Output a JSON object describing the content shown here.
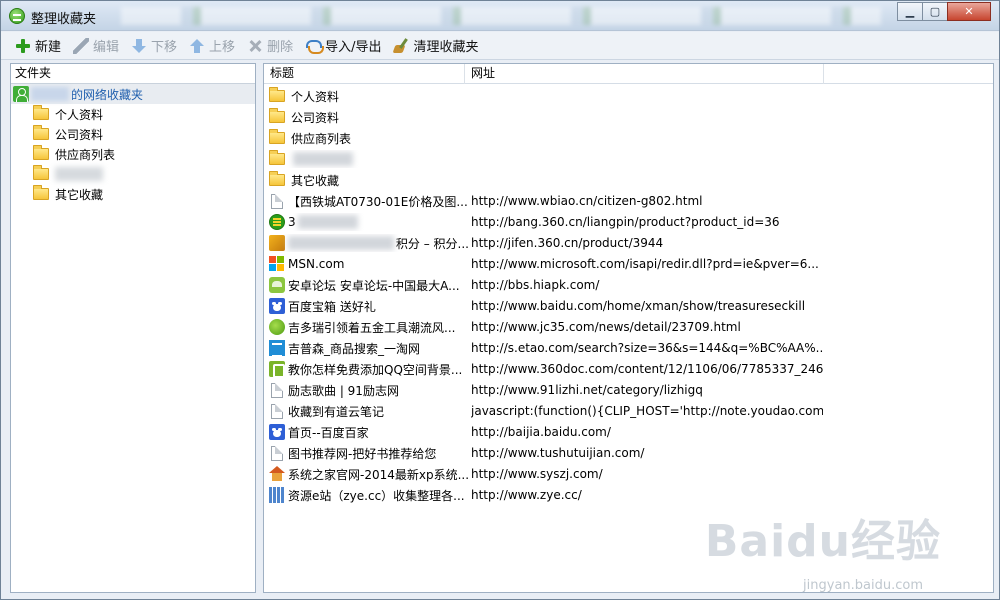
{
  "window": {
    "title": "整理收藏夹"
  },
  "toolbar": {
    "new_label": "新建",
    "edit_label": "编辑",
    "move_down_label": "下移",
    "move_up_label": "上移",
    "delete_label": "删除",
    "import_export_label": "导入/导出",
    "clean_label": "清理收藏夹"
  },
  "folders_pane": {
    "header": "文件夹",
    "root_label": "的网络收藏夹",
    "items": [
      {
        "label": "个人资料"
      },
      {
        "label": "公司资料"
      },
      {
        "label": "供应商列表"
      },
      {
        "label": ""
      },
      {
        "label": "其它收藏"
      }
    ]
  },
  "bookmarks": {
    "columns": {
      "title": "标题",
      "url": "网址"
    },
    "rows": [
      {
        "title": "个人资料",
        "url": "",
        "icon": "folder-icon"
      },
      {
        "title": "公司资料",
        "url": "",
        "icon": "folder-icon"
      },
      {
        "title": "供应商列表",
        "url": "",
        "icon": "folder-icon"
      },
      {
        "title": "",
        "url": "",
        "icon": "folder-icon"
      },
      {
        "title": "其它收藏",
        "url": "",
        "icon": "folder-icon"
      },
      {
        "title": "【西铁城AT0730-01E价格及图...",
        "url": "http://www.wbiao.cn/citizen-g802.html",
        "icon": "page-icon"
      },
      {
        "title": "3",
        "url": "http://bang.360.cn/liangpin/product?product_id=36",
        "icon": "360-icon"
      },
      {
        "title": "积分 – 积分...",
        "url": "http://jifen.360.cn/product/3944",
        "icon": "jifen-icon"
      },
      {
        "title": "MSN.com",
        "url": "http://www.microsoft.com/isapi/redir.dll?prd=ie&pver=6...",
        "icon": "msn-icon"
      },
      {
        "title": "安卓论坛 安卓论坛-中国最大A...",
        "url": "http://bbs.hiapk.com/",
        "icon": "android-icon"
      },
      {
        "title": "百度宝箱 送好礼",
        "url": "http://www.baidu.com/home/xman/show/treasureseckill",
        "icon": "baidu-icon"
      },
      {
        "title": "吉多瑞引领着五金工具潮流风...",
        "url": "http://www.jc35.com/news/detail/23709.html",
        "icon": "leaf-icon"
      },
      {
        "title": "吉普森_商品搜索_一淘网",
        "url": "http://s.etao.com/search?size=36&s=144&q=%BC%AA%...",
        "icon": "etao-icon"
      },
      {
        "title": "教你怎样免费添加QQ空间背景...",
        "url": "http://www.360doc.com/content/12/1106/06/7785337_246...",
        "icon": "360doc-icon"
      },
      {
        "title": "励志歌曲 | 91励志网",
        "url": "http://www.91lizhi.net/category/lizhigq",
        "icon": "page-icon"
      },
      {
        "title": "收藏到有道云笔记",
        "url": "javascript:(function(){CLIP_HOST='http://note.youdao.com/...",
        "icon": "page-icon"
      },
      {
        "title": "首页--百度百家",
        "url": "http://baijia.baidu.com/",
        "icon": "baidu-icon"
      },
      {
        "title": "图书推荐网-把好书推荐给您",
        "url": "http://www.tushutuijian.com/",
        "icon": "page-icon"
      },
      {
        "title": "系统之家官网-2014最新xp系统...",
        "url": "http://www.syszj.com/",
        "icon": "house-icon"
      },
      {
        "title": "资源e站（zye.cc）收集整理各...",
        "url": "http://www.zye.cc/",
        "icon": "grid-icon"
      }
    ]
  },
  "watermark": {
    "main": "Baidu经验",
    "sub": "jingyan.baidu.com"
  }
}
